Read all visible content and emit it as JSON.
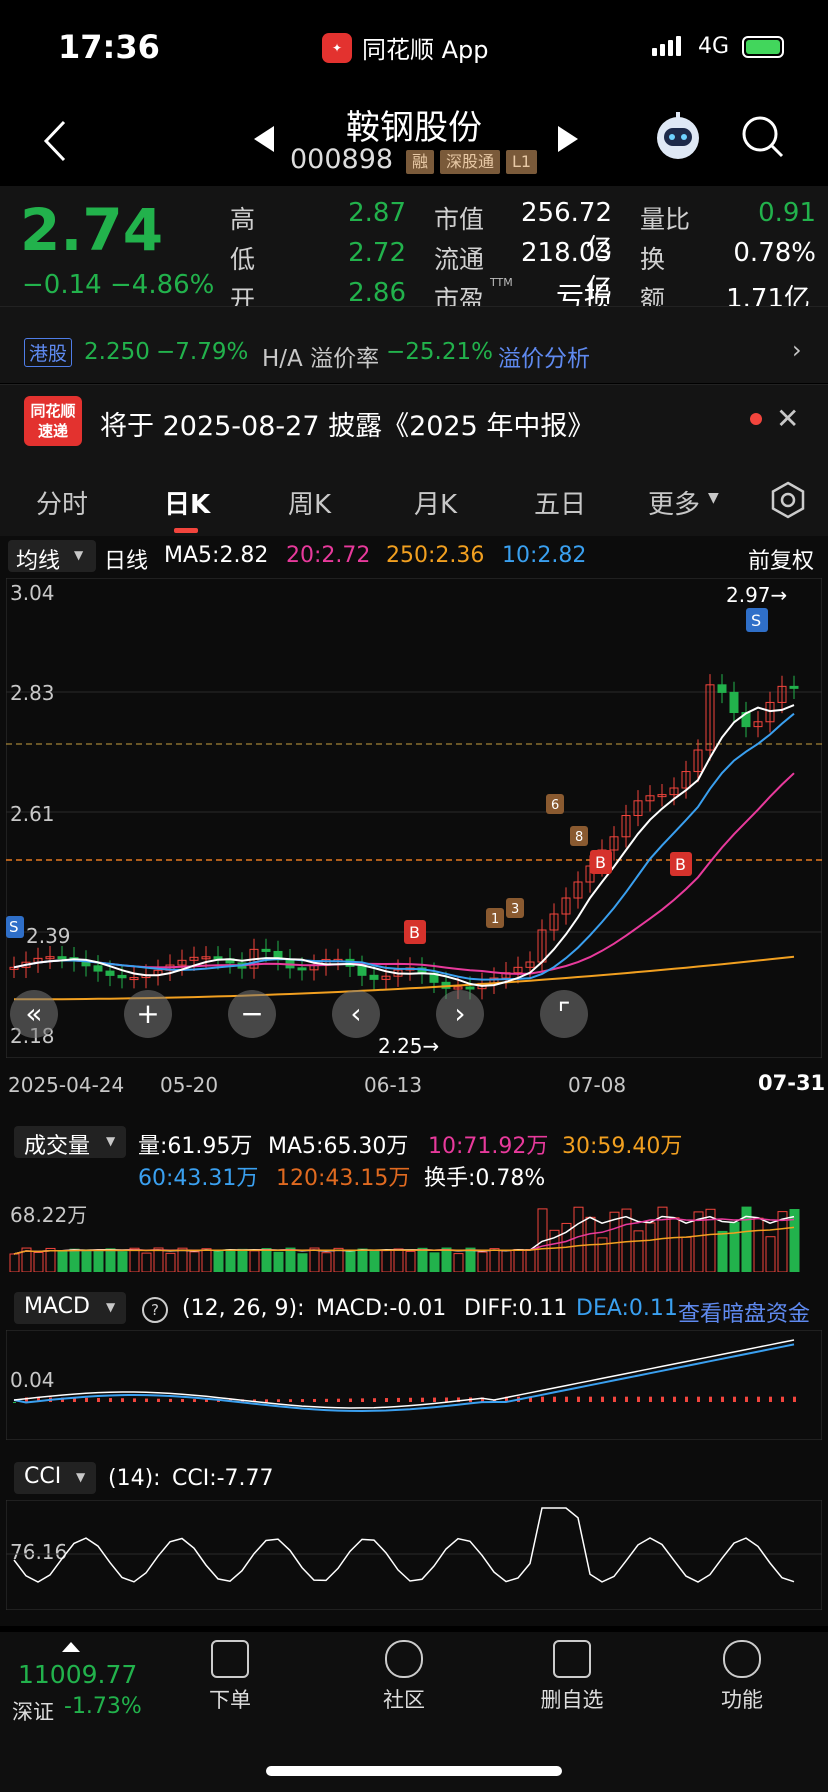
{
  "status_bar": {
    "time": "17:36",
    "app_name": "同花顺 App",
    "network": "4G"
  },
  "header": {
    "stock_name": "鞍钢股份",
    "stock_code": "000898",
    "tags": [
      "融",
      "深股通",
      "L1"
    ]
  },
  "quote": {
    "price": "2.74",
    "change": "−0.14",
    "change_pct": "−4.86%",
    "high_label": "高",
    "high": "2.87",
    "low_label": "低",
    "low": "2.72",
    "open_label": "开",
    "open": "2.86",
    "mktcap_label": "市值",
    "mktcap": "256.72亿",
    "float_label": "流通",
    "float": "218.03亿",
    "pe_label": "市盈",
    "pe_sup": "TTM",
    "pe": "亏损",
    "volratio_label": "量比",
    "volratio": "0.91",
    "turnover_label": "换",
    "turnover": "0.78%",
    "amount_label": "额",
    "amount": "1.71亿"
  },
  "hk": {
    "badge": "港股",
    "price": "2.250",
    "pct": "−7.79%",
    "premium_label": "H/A 溢价率",
    "premium": "−25.21%",
    "link": "溢价分析"
  },
  "notice": {
    "logo_top": "同花顺",
    "logo_bottom": "速递",
    "text": "将于 2025-08-27 披露《2025 年中报》"
  },
  "tabs": [
    "分时",
    "日K",
    "周K",
    "月K",
    "五日",
    "更多"
  ],
  "kline": {
    "indicator": "均线",
    "period": "日线",
    "ma5": "MA5:2.82",
    "ma20": "20:2.72",
    "ma250": "250:2.36",
    "ma10": "10:2.82",
    "adjust": "前复权",
    "y_ticks": [
      "3.04",
      "2.83",
      "2.61",
      "2.39",
      "2.18"
    ],
    "high_mark": "2.97→",
    "low_mark": "2.25→",
    "dates": [
      "2025-04-24",
      "05-20",
      "06-13",
      "07-08",
      "07-31"
    ],
    "colors": {
      "up": "#f2453d",
      "down": "#22b24c",
      "ma5": "#ffffff",
      "ma10": "#3aa0f0",
      "ma20": "#e83a9c",
      "ma250": "#f2a020"
    }
  },
  "volume": {
    "title": "成交量",
    "vol": "量:61.95万",
    "ma5": "MA5:65.30万",
    "ma10": "10:71.92万",
    "ma30": "30:59.40万",
    "ma60": "60:43.31万",
    "ma120": "120:43.15万",
    "turnover": "换手:0.78%",
    "y_tick": "68.22万"
  },
  "macd": {
    "title": "MACD",
    "params": "(12, 26, 9):",
    "macd": "MACD:-0.01",
    "diff": "DIFF:0.11",
    "dea": "DEA:0.11",
    "link": "查看暗盘资金",
    "y_tick": "0.04"
  },
  "cci": {
    "title": "CCI",
    "params": "(14):",
    "cci": "CCI:-7.77",
    "y_tick": "76.16"
  },
  "bottom": {
    "index_value": "11009.77",
    "index_name": "深证",
    "index_pct": "-1.73%",
    "items": [
      "下单",
      "社区",
      "删自选",
      "功能"
    ]
  }
}
